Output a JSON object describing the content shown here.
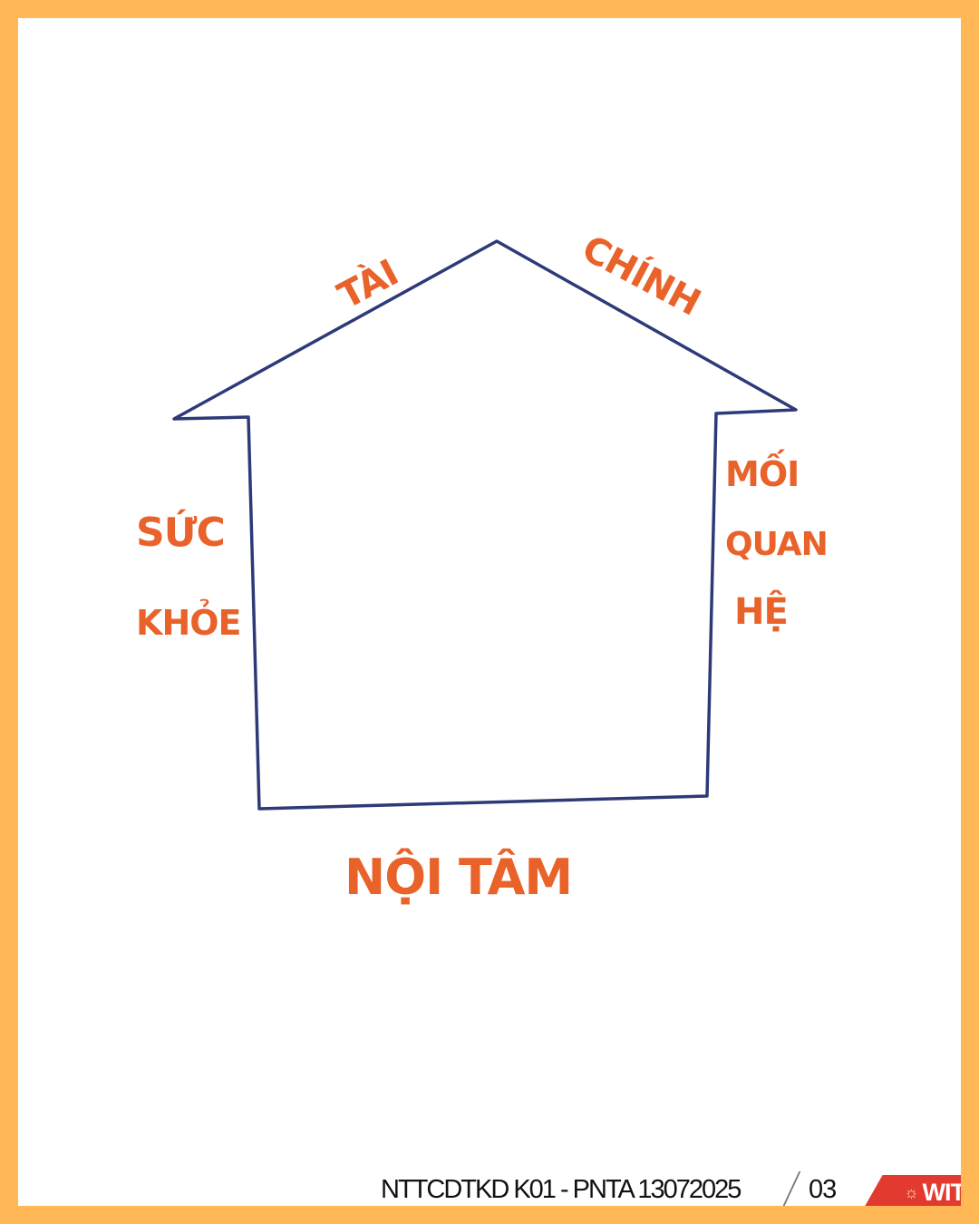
{
  "diagram": {
    "labels": {
      "top_left": "TÀI",
      "top_right": "CHÍNH",
      "left_line1": "SỨC",
      "left_line2": "KHỎE",
      "right_line1": "MỐI",
      "right_line2": "QUAN",
      "right_line3": "HỆ",
      "bottom": "NỘI TÂM"
    },
    "colors": {
      "house_outline": "#2E3A78",
      "label_text": "#E8622A",
      "frame": "#FFB855",
      "accent": "#E23A2F"
    }
  },
  "footer": {
    "text": "NTTCDTKD K01 - PNTA  13072025",
    "page_number": "03",
    "logo_text": "WIT",
    "logo_icon": "sun-icon"
  }
}
